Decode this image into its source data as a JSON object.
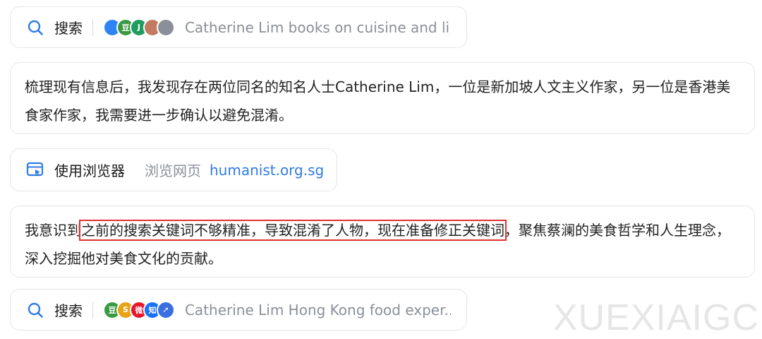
{
  "step1": {
    "label": "搜索",
    "favicons": [
      {
        "name": "bubble-favicon",
        "color": "#2f84f5",
        "glyph": ""
      },
      {
        "name": "douban-favicon",
        "color": "#3a9a42",
        "glyph": "豆"
      },
      {
        "name": "green-brand-favicon",
        "color": "#1f9d61",
        "glyph": "J"
      },
      {
        "name": "portrait-favicon",
        "color": "#c27a60",
        "glyph": ""
      },
      {
        "name": "photo-favicon",
        "color": "#8b8f99",
        "glyph": ""
      }
    ],
    "query": "Catherine Lim books on cuisine and li..."
  },
  "thought1": {
    "text": "梳理现有信息后，我发现存在两位同名的知名人士Catherine Lim，一位是新加坡人文主义作家，另一位是香港美食家作家，我需要进一步确认以避免混淆。"
  },
  "step2": {
    "label": "使用浏览器",
    "sub": "浏览网页",
    "url": "humanist.org.sg"
  },
  "thought2": {
    "before": "我意识到",
    "highlight": "之前的搜索关键词不够精准，导致混淆了人物，现在准备修正关键词",
    "after": "，聚焦蔡澜的美食哲学和人生理念，深入挖掘他对美食文化的贡献。"
  },
  "step3": {
    "label": "搜索",
    "favicons": [
      {
        "name": "douban-favicon",
        "color": "#3a9a42",
        "glyph": "豆"
      },
      {
        "name": "sohu-favicon",
        "color": "#e8a317",
        "glyph": "S"
      },
      {
        "name": "weibo-favicon",
        "color": "#e6162d",
        "glyph": "微"
      },
      {
        "name": "zhihu-favicon",
        "color": "#1772f6",
        "glyph": "知"
      },
      {
        "name": "rocket-favicon",
        "color": "#3b6fe0",
        "glyph": "➚"
      }
    ],
    "query": "Catherine Lim Hong Kong food exper..."
  },
  "watermark": "XUEXIAIGC",
  "colors": {
    "link": "#2f7be5",
    "highlight_border": "#e0312f",
    "card_border": "#e4e6ea"
  }
}
